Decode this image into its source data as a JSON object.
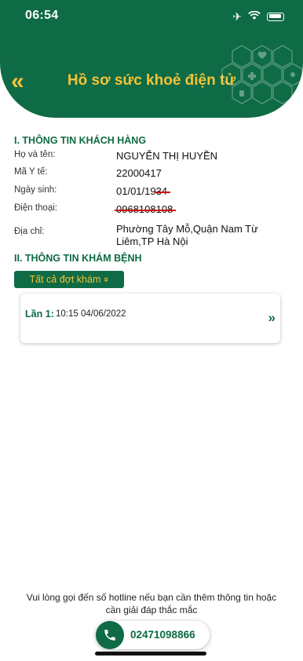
{
  "status_bar": {
    "time": "06:54"
  },
  "header": {
    "title": "Hồ sơ sức khoẻ điện tử",
    "back_icon": "double-chevron-left-icon"
  },
  "customer": {
    "section_title": "I. THÔNG TIN KHÁCH HÀNG",
    "fields": [
      {
        "label": "Họ và tên:",
        "value": "NGUYỄN THỊ HUYỀN"
      },
      {
        "label": "Mã Y tế:",
        "value": "22000417"
      },
      {
        "label": "Ngày sinh:",
        "value_prefix": "01/01/19",
        "value_struck": "34"
      },
      {
        "label": "Điện thoại:",
        "value_struck": "0968108108"
      },
      {
        "label": "Địa chỉ:",
        "value": "Phường Tây Mỗ,Quận Nam Từ Liêm,TP Hà Nội"
      }
    ]
  },
  "exam": {
    "section_title": "II. THÔNG TIN KHÁM BỆNH",
    "filter_label": "Tất cả đợt khám",
    "visits": [
      {
        "label": "Lần 1:",
        "datetime": "10:15 04/06/2022"
      }
    ]
  },
  "footer": {
    "note": "Vui lòng gọi đến số hotline nếu bạn cần thêm thông tin hoặc cần giải đáp thắc mắc",
    "hotline": "02471098866"
  },
  "colors": {
    "primary": "#0e6b45",
    "accent": "#f3c338",
    "redaction": "#d10000"
  }
}
